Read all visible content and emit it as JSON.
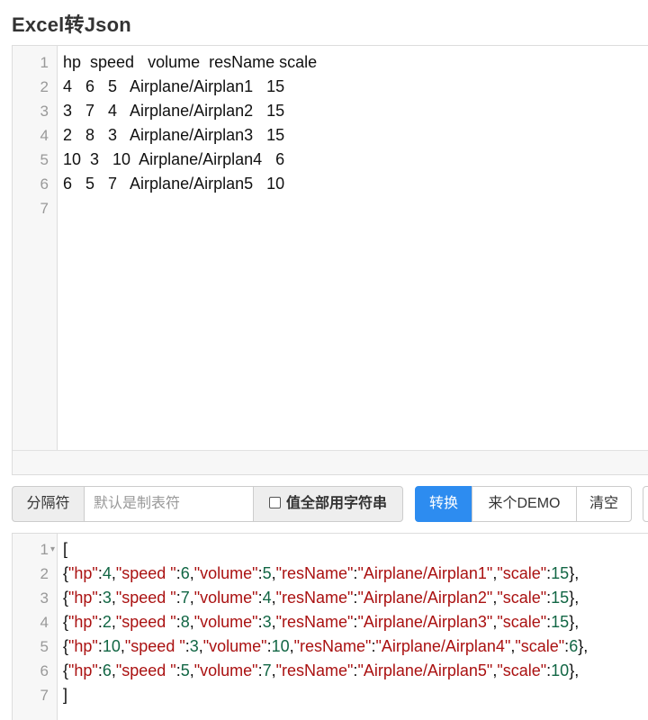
{
  "title": "Excel转Json",
  "input_editor": {
    "lines": [
      "hp  speed   volume  resName scale",
      "4   6   5   Airplane/Airplan1   15",
      "3   7   4   Airplane/Airplan2   15",
      "2   8   3   Airplane/Airplan3   15",
      "10  3   10  Airplane/Airplan4   6",
      "6   5   7   Airplane/Airplan5   10",
      ""
    ]
  },
  "toolbar": {
    "separator_label": "分隔符",
    "separator_placeholder": "默认是制表符",
    "all_string_label": "值全部用字符串",
    "convert_label": "转换",
    "demo_label": "来个DEMO",
    "clear_label": "清空"
  },
  "output_editor": {
    "rows": [
      {
        "hp": "4",
        "speed": "6",
        "volume": "5",
        "resName": "Airplane/Airplan1",
        "scale": "15",
        "tail": "},"
      },
      {
        "hp": "3",
        "speed": "7",
        "volume": "4",
        "resName": "Airplane/Airplan2",
        "scale": "15",
        "tail": "},"
      },
      {
        "hp": "2",
        "speed": "8",
        "volume": "3",
        "resName": "Airplane/Airplan3",
        "scale": "15",
        "tail": "},"
      },
      {
        "hp": "10",
        "speed": "3",
        "volume": "10",
        "resName": "Airplane/Airplan4",
        "scale": "6",
        "tail": "},"
      },
      {
        "hp": "6",
        "speed": "5",
        "volume": "7",
        "resName": "Airplane/Airplan5",
        "scale": "10",
        "tail": "},"
      }
    ],
    "open": "[",
    "close": "]",
    "keys": {
      "hp": "\"hp\"",
      "speed": "\"speed \"",
      "volume": "\"volume\"",
      "resName": "\"resName\"",
      "scale": "\"scale\""
    }
  }
}
